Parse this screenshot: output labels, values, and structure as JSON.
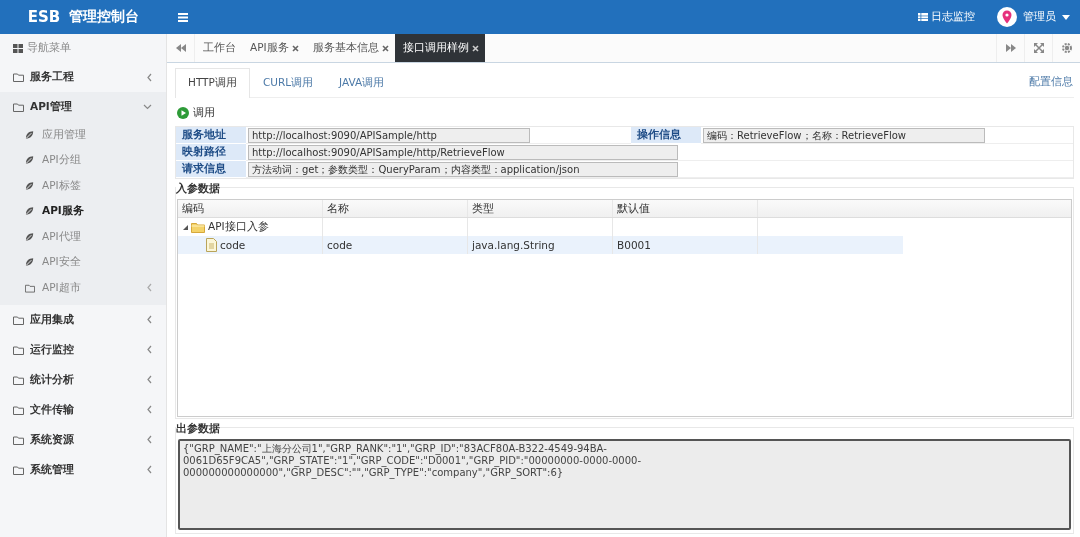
{
  "header": {
    "brand": "ESB",
    "title": "管理控制台",
    "log_monitor": "日志监控",
    "user": "管理员"
  },
  "sidebar": {
    "title": "导航菜单",
    "items": [
      {
        "label": "服务工程",
        "expanded": false
      },
      {
        "label": "API管理",
        "expanded": true,
        "children": [
          {
            "label": "应用管理",
            "kind": "leaf",
            "selected": false
          },
          {
            "label": "API分组",
            "kind": "leaf",
            "selected": false
          },
          {
            "label": "API标签",
            "kind": "leaf",
            "selected": false
          },
          {
            "label": "API服务",
            "kind": "leaf",
            "selected": true
          },
          {
            "label": "API代理",
            "kind": "leaf",
            "selected": false
          },
          {
            "label": "API安全",
            "kind": "leaf",
            "selected": false
          },
          {
            "label": "API超市",
            "kind": "folder",
            "selected": false
          }
        ]
      },
      {
        "label": "应用集成",
        "expanded": false
      },
      {
        "label": "运行监控",
        "expanded": false
      },
      {
        "label": "统计分析",
        "expanded": false
      },
      {
        "label": "文件传输",
        "expanded": false
      },
      {
        "label": "系统资源",
        "expanded": false
      },
      {
        "label": "系统管理",
        "expanded": false
      }
    ]
  },
  "tabs": [
    {
      "label": "工作台",
      "closable": false,
      "selected": false
    },
    {
      "label": "API服务",
      "closable": true,
      "selected": false
    },
    {
      "label": "服务基本信息",
      "closable": true,
      "selected": false
    },
    {
      "label": "接口调用样例",
      "closable": true,
      "selected": true
    }
  ],
  "subtabs": [
    {
      "label": "HTTP调用",
      "selected": true
    },
    {
      "label": "CURL调用",
      "selected": false
    },
    {
      "label": "JAVA调用",
      "selected": false
    }
  ],
  "config_link": "配置信息",
  "invoke_button": "调用",
  "info": {
    "service_address": {
      "label": "服务地址",
      "value": "http://localhost:9090/APISample/http"
    },
    "operation_info": {
      "label": "操作信息",
      "value": "编码：RetrieveFlow；名称：RetrieveFlow"
    },
    "mapping_path": {
      "label": "映射路径",
      "value": "http://localhost:9090/APISample/http/RetrieveFlow"
    },
    "request_info": {
      "label": "请求信息",
      "value": "方法动词：get；参数类型：QueryParam；内容类型：application/json"
    }
  },
  "input_params": {
    "title": "入参数据",
    "columns": [
      "编码",
      "名称",
      "类型",
      "默认值"
    ],
    "rows": [
      {
        "code": "API接口入参",
        "name": "",
        "type": "",
        "default": "",
        "expanded": true,
        "selected": false,
        "children": [
          {
            "code": "code",
            "name": "code",
            "type": "java.lang.String",
            "default": "B0001",
            "selected": true
          }
        ]
      }
    ]
  },
  "output_params": {
    "title": "出参数据",
    "value": "{\"GRP_NAME\":\"上海分公司1\",\"GRP_RANK\":\"1\",\"GRP_ID\":\"83ACF80A-B322-4549-94BA-0061D65F9CA5\",\"GRP_STATE\":\"1\",\"GRP_CODE\":\"D0001\",\"GRP_PID\":\"00000000-0000-0000-000000000000000\",\"GRP_DESC\":\"\",\"GRP_TYPE\":\"company\",\"GRP_SORT\":6}"
  }
}
